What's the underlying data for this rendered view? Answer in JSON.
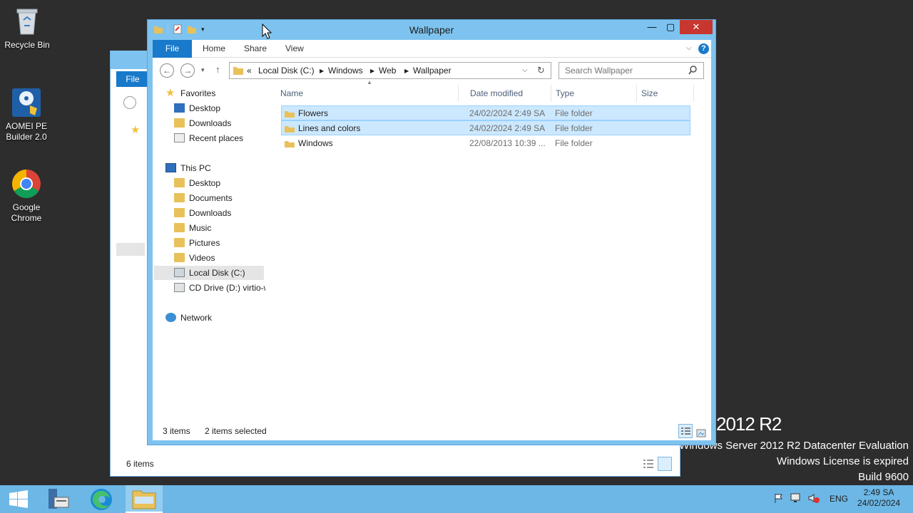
{
  "desktop": {
    "icons": [
      {
        "label": "Recycle Bin",
        "icon": "recycle-bin-icon"
      },
      {
        "label": "AOMEI PE Builder 2.0",
        "icon": "aomei-icon"
      },
      {
        "label": "Google Chrome",
        "icon": "chrome-icon"
      }
    ],
    "watermark": {
      "big": "2012 R2",
      "line1": "Windows Server 2012 R2 Datacenter Evaluation",
      "line2": "Windows License is expired",
      "line3": "Build 9600"
    }
  },
  "back_window": {
    "file_tab": "File",
    "status_items": "6 items"
  },
  "window": {
    "title": "Wallpaper",
    "controls": {
      "minimize": "—",
      "maximize": "▢",
      "close": "✕"
    },
    "ribbon_tabs": [
      "File",
      "Home",
      "Share",
      "View"
    ],
    "address": {
      "prefix": "«",
      "crumbs": [
        "Local Disk (C:)",
        "Windows",
        "Web",
        "Wallpaper"
      ]
    },
    "search": {
      "placeholder": "Search Wallpaper"
    },
    "nav": {
      "favorites_label": "Favorites",
      "favorites": [
        "Desktop",
        "Downloads",
        "Recent places"
      ],
      "thispc_label": "This PC",
      "thispc": [
        "Desktop",
        "Documents",
        "Downloads",
        "Music",
        "Pictures",
        "Videos",
        "Local Disk (C:)",
        "CD Drive (D:) virtio-w"
      ],
      "network_label": "Network"
    },
    "columns": [
      "Name",
      "Date modified",
      "Type",
      "Size"
    ],
    "files": [
      {
        "name": "Flowers",
        "date": "24/02/2024 2:49 SA",
        "type": "File folder",
        "selected": true
      },
      {
        "name": "Lines and colors",
        "date": "24/02/2024 2:49 SA",
        "type": "File folder",
        "selected": true
      },
      {
        "name": "Windows",
        "date": "22/08/2013 10:39 ...",
        "type": "File folder",
        "selected": false
      }
    ],
    "status": {
      "count": "3 items",
      "selected": "2 items selected"
    }
  },
  "taskbar": {
    "tray_lang": "ENG",
    "time": "2:49 SA",
    "date": "24/02/2024"
  },
  "colors": {
    "window_frame": "#7ec3ef",
    "file_tab": "#1979ca",
    "selection": "#cce8ff",
    "taskbar": "#6cb7e6",
    "desktop": "#2d2d2d"
  }
}
